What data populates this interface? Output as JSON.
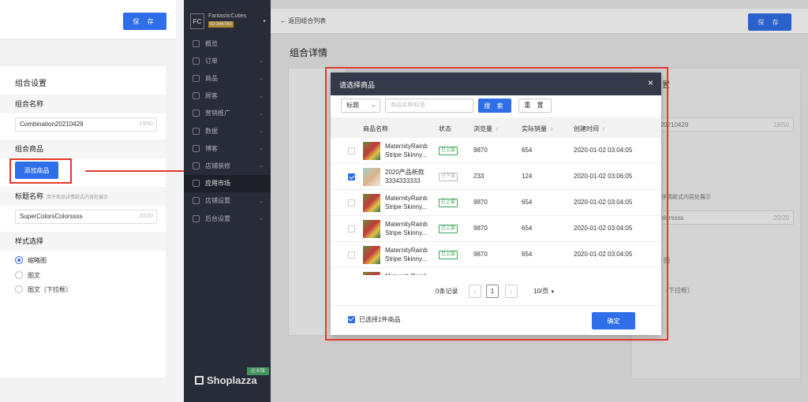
{
  "left": {
    "save_label": "保 存",
    "settings_title": "组合设置",
    "name_label": "组合名称",
    "name_value": "Combination20210429",
    "name_count": "19/50",
    "products_label": "组合商品",
    "add_product_label": "添加商品",
    "title_label": "标题名称",
    "title_hint": "用于商品详情款式内容处展示",
    "title_value": "SuperColorsColorssss",
    "title_count": "20/20",
    "style_label": "样式选择",
    "style_options": [
      "缩略图",
      "图文",
      "图文（下拉框）"
    ],
    "style_selected": "缩略图"
  },
  "sidebar": {
    "store_initials": "FC",
    "store_name": "FantasticCuties",
    "store_id": "ID:346769",
    "items": [
      {
        "label": "概览",
        "icon": "dashboard-icon",
        "chevron": false
      },
      {
        "label": "订单",
        "icon": "orders-icon",
        "chevron": true
      },
      {
        "label": "商品",
        "icon": "products-icon",
        "chevron": true
      },
      {
        "label": "顾客",
        "icon": "customers-icon",
        "chevron": true
      },
      {
        "label": "营销推广",
        "icon": "marketing-icon",
        "chevron": true
      },
      {
        "label": "数据",
        "icon": "analytics-icon",
        "chevron": true
      },
      {
        "label": "博客",
        "icon": "blog-icon",
        "chevron": true
      },
      {
        "label": "店铺装修",
        "icon": "theme-icon",
        "chevron": true
      },
      {
        "label": "应用市场",
        "icon": "apps-icon",
        "chevron": false,
        "active": true
      },
      {
        "label": "店铺设置",
        "icon": "store-settings-icon",
        "chevron": true
      },
      {
        "label": "后台设置",
        "icon": "admin-settings-icon",
        "chevron": true
      }
    ],
    "brand": "Shoplazza",
    "plan_badge": "企业版"
  },
  "main": {
    "back_label": "返回组合列表",
    "save_label": "保 存",
    "page_title": "组合详情",
    "bg_settings_fragment": "置",
    "bg_name_value": "mbination20210429",
    "bg_count": "19/50",
    "bg_add_fragment": "商品",
    "bg_hint_fragment": "称  用于商品详情款式内容处展示",
    "bg_title_value": "ColorsColorssss",
    "bg_title_count": "20/20",
    "bg_style_fragment": "图",
    "bg_dropdown_fragment": "（下拉框）"
  },
  "modal": {
    "title": "请选择商品",
    "filter_select": "标题",
    "search_placeholder": "商品名称/标签",
    "search_label": "搜 索",
    "reset_label": "重 置",
    "columns": [
      "商品名称",
      "状态",
      "浏览量",
      "实际销量",
      "创建时间"
    ],
    "rows": [
      {
        "name": "MaternityRainb Stripe Skinny...",
        "status": "已上架",
        "views": "9870",
        "sales": "654",
        "created": "2020-01-02 03:04:05",
        "checked": false
      },
      {
        "name": "2020产品新款 3334333333",
        "status": "已下架",
        "views": "233",
        "sales": "124",
        "created": "2020-01-02 03:06:05",
        "checked": true
      },
      {
        "name": "MaternityRainb Stripe Skinny...",
        "status": "已上架",
        "views": "9870",
        "sales": "654",
        "created": "2020-01-02 03:04:05",
        "checked": false
      },
      {
        "name": "MaternityRainb Stripe Skinny...",
        "status": "已上架",
        "views": "9870",
        "sales": "654",
        "created": "2020-01-02 03:04:05",
        "checked": false
      },
      {
        "name": "MaternityRainb Stripe Skinny...",
        "status": "已上架",
        "views": "9870",
        "sales": "654",
        "created": "2020-01-02 03:04:05",
        "checked": false
      },
      {
        "name": "MaternityRainb",
        "status": "",
        "views": "",
        "sales": "",
        "created": "",
        "checked": false
      }
    ],
    "record_count": "0条记录",
    "current_page": "1",
    "page_size": "10/页",
    "selected_summary": "已选择1件商品",
    "confirm_label": "确定"
  },
  "colors": {
    "primary": "#2f6ee9",
    "sidebar": "#2e3240",
    "annotation": "#e43a2a",
    "on_shelf": "#3aa55c"
  }
}
